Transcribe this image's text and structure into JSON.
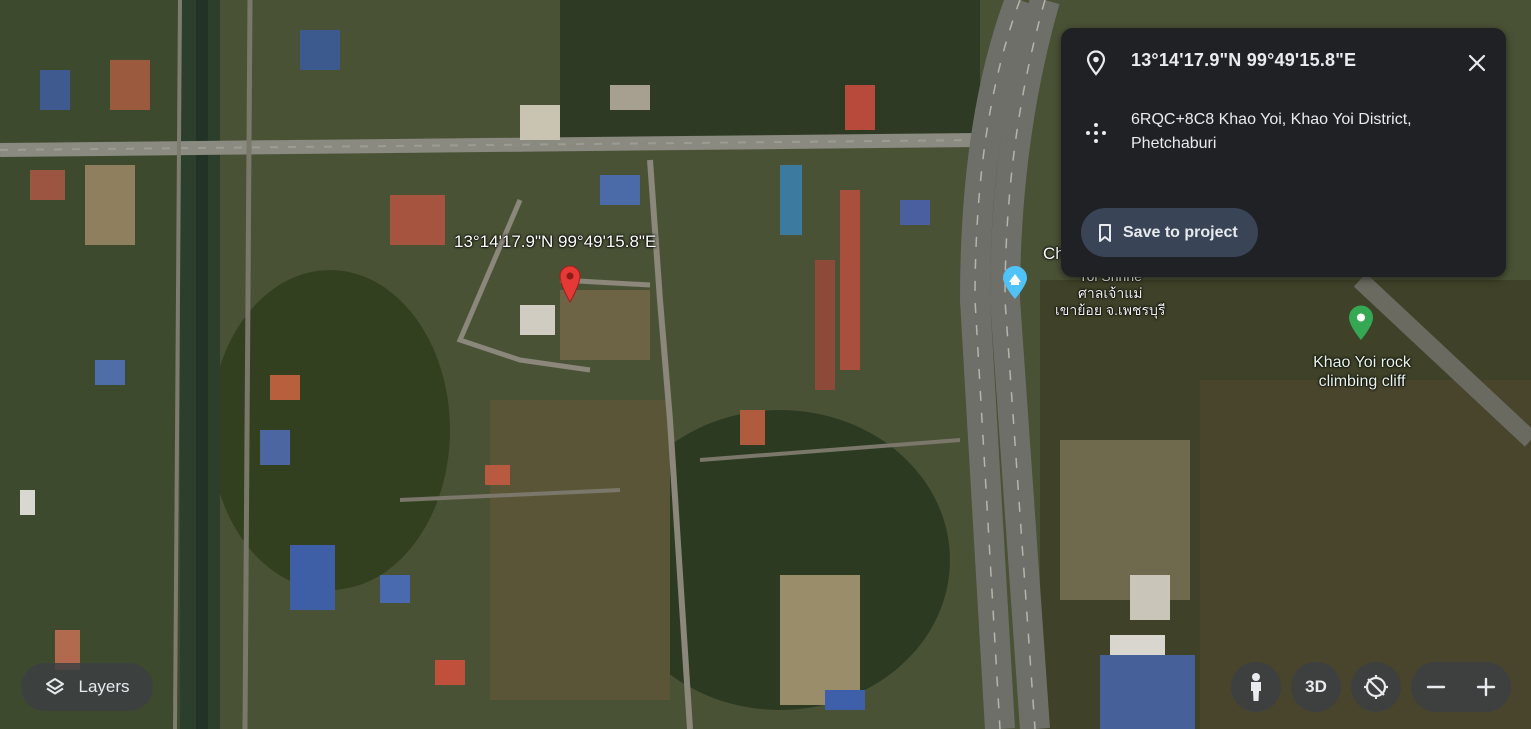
{
  "map": {
    "pin_label": "13°14'17.9\"N 99°49'15.8\"E",
    "shrine_label_partial": "Ch",
    "shrine_label_line2": "Yoi Shrine",
    "shrine_label_thai1": "ศาลเจ้าแม่",
    "shrine_label_thai2": "เขาย้อย จ.เพชรบุรี",
    "poi_name_line1": "Khao Yoi rock",
    "poi_name_line2": "climbing cliff",
    "colors": {
      "pin": "#e53935",
      "poi_marker": "#34a853",
      "shrine_marker": "#4fc3f7"
    }
  },
  "info_panel": {
    "coordinates": "13°14'17.9\"N 99°49'15.8\"E",
    "address_line1": "6RQC+8C8 Khao Yoi, Khao Yoi District,",
    "address_line2": "Phetchaburi",
    "save_label": "Save to project",
    "icons": [
      "location-pin-icon",
      "plus-code-icon",
      "close-icon",
      "bookmark-icon"
    ]
  },
  "controls": {
    "layers_label": "Layers",
    "btn_3d_label": "3D",
    "zoom_out": "−",
    "zoom_in": "+"
  }
}
